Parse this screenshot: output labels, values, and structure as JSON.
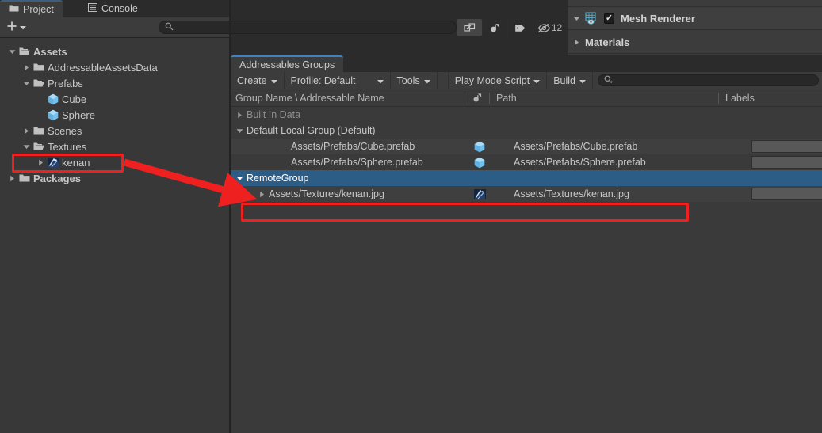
{
  "project_panel": {
    "tabs": [
      {
        "label": "Project",
        "icon": "folder-icon",
        "active": true
      },
      {
        "label": "Console",
        "icon": "console-icon",
        "active": false
      }
    ],
    "header_icons": [
      "lock-icon",
      "kebab-menu-icon"
    ],
    "toolbar": {
      "add_label": "+",
      "add_dropdown_icon": "chevron-down-icon",
      "search_placeholder": "",
      "search_icon": "search-icon",
      "icons": [
        "popout-icon",
        "object-filter-icon",
        "label-filter-icon"
      ],
      "hidden_count": "12",
      "hidden_count_icon": "eye-off-icon"
    },
    "tree": [
      {
        "label": "Assets",
        "depth": 0,
        "expanded": true,
        "icon": "folder-open-icon",
        "bold": true
      },
      {
        "label": "AddressableAssetsData",
        "depth": 1,
        "expanded": false,
        "icon": "folder-icon",
        "bold": false
      },
      {
        "label": "Prefabs",
        "depth": 1,
        "expanded": true,
        "icon": "folder-open-icon",
        "bold": false
      },
      {
        "label": "Cube",
        "depth": 2,
        "expanded": null,
        "icon": "prefab-cube-icon",
        "bold": false
      },
      {
        "label": "Sphere",
        "depth": 2,
        "expanded": null,
        "icon": "prefab-cube-icon",
        "bold": false
      },
      {
        "label": "Scenes",
        "depth": 1,
        "expanded": false,
        "icon": "folder-icon",
        "bold": false
      },
      {
        "label": "Textures",
        "depth": 1,
        "expanded": true,
        "icon": "folder-open-icon",
        "bold": false
      },
      {
        "label": "kenan",
        "depth": 2,
        "expanded": false,
        "icon": "texture-thumbnail-icon",
        "bold": false,
        "highlighted": true
      },
      {
        "label": "Packages",
        "depth": 0,
        "expanded": false,
        "icon": "folder-icon",
        "bold": true
      }
    ]
  },
  "inspector": {
    "mesh_renderer": {
      "label": "Mesh Renderer",
      "expanded": true,
      "enabled": true,
      "icon": "mesh-renderer-icon",
      "checkbox_glyph": "✓"
    },
    "materials": {
      "label": "Materials",
      "expanded": false
    }
  },
  "addressables": {
    "tab_label": "Addressables Groups",
    "toolbar": {
      "create_label": "Create",
      "profile_label": "Profile: Default",
      "tools_label": "Tools",
      "play_mode_script_label": "Play Mode Script",
      "build_label": "Build",
      "search_placeholder": "",
      "search_icon": "search-icon",
      "dropdown_icon": "chevron-down-icon"
    },
    "columns": [
      {
        "key": "name",
        "label": "Group Name \\ Addressable Name"
      },
      {
        "key": "type",
        "label": "",
        "icon": "asset-type-icon"
      },
      {
        "key": "path",
        "label": "Path"
      },
      {
        "key": "labels",
        "label": "Labels"
      }
    ],
    "rows": [
      {
        "kind": "group",
        "indent": 0,
        "expanded": false,
        "dim": true,
        "name": "Built In Data",
        "type_icon": "",
        "path": "",
        "labels": false,
        "selected": false,
        "striped": false
      },
      {
        "kind": "group",
        "indent": 0,
        "expanded": true,
        "dim": false,
        "name": "Default Local Group (Default)",
        "type_icon": "",
        "path": "",
        "labels": false,
        "selected": false,
        "striped": false
      },
      {
        "kind": "asset",
        "indent": 2,
        "expanded": null,
        "dim": false,
        "name": "Assets/Prefabs/Cube.prefab",
        "type_icon": "prefab-cube-icon",
        "path": "Assets/Prefabs/Cube.prefab",
        "labels": true,
        "selected": false,
        "striped": true
      },
      {
        "kind": "asset",
        "indent": 2,
        "expanded": null,
        "dim": false,
        "name": "Assets/Prefabs/Sphere.prefab",
        "type_icon": "prefab-cube-icon",
        "path": "Assets/Prefabs/Sphere.prefab",
        "labels": true,
        "selected": false,
        "striped": false
      },
      {
        "kind": "group",
        "indent": 0,
        "expanded": true,
        "dim": false,
        "name": "RemoteGroup",
        "type_icon": "",
        "path": "",
        "labels": false,
        "selected": true,
        "striped": false
      },
      {
        "kind": "asset",
        "indent": 1,
        "expanded": false,
        "dim": false,
        "name": "Assets/Textures/kenan.jpg",
        "type_icon": "texture-thumbnail-icon",
        "path": "Assets/Textures/kenan.jpg",
        "labels": true,
        "selected": false,
        "striped": true,
        "highlighted": true
      }
    ]
  },
  "annotations": {
    "color": "#ee2020",
    "box_tree_kenan": "kenan texture in Project tree",
    "box_addr_row": "Assets/Textures/kenan.jpg row in RemoteGroup",
    "arrow": "points from kenan tree entry to RemoteGroup row"
  }
}
